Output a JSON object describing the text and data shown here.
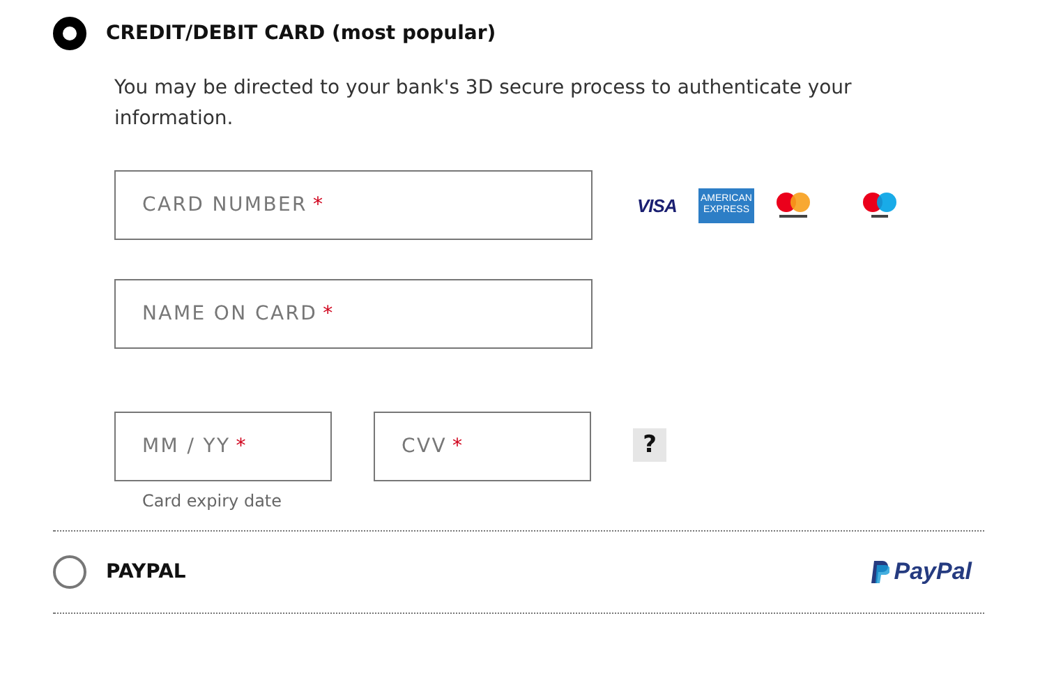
{
  "payment_options": [
    {
      "kind": "card",
      "label": "CREDIT/DEBIT CARD (most popular)",
      "selected": true,
      "note": "You may be directed to your bank's 3D secure process to authenticate your information.",
      "fields": [
        {
          "kind": "wide",
          "placeholder": "CARD NUMBER",
          "required": true
        },
        {
          "kind": "wide",
          "placeholder": "NAME ON CARD",
          "required": true
        },
        {
          "kind": "expiry",
          "placeholder": "MM / YY",
          "required": true,
          "helper": "Card expiry date"
        },
        {
          "kind": "cvv",
          "placeholder": "CVV",
          "required": true,
          "help": "?"
        }
      ],
      "logos": [
        {
          "kind": "visa",
          "text": "VISA"
        },
        {
          "kind": "amex",
          "text": "AMERICAN EXPRESS"
        },
        {
          "kind": "mastercard"
        },
        {
          "kind": "maestro"
        }
      ]
    },
    {
      "kind": "paypal",
      "label": "PAYPAL",
      "selected": false,
      "logo_text": "PayPal"
    }
  ],
  "required_mark": "*"
}
